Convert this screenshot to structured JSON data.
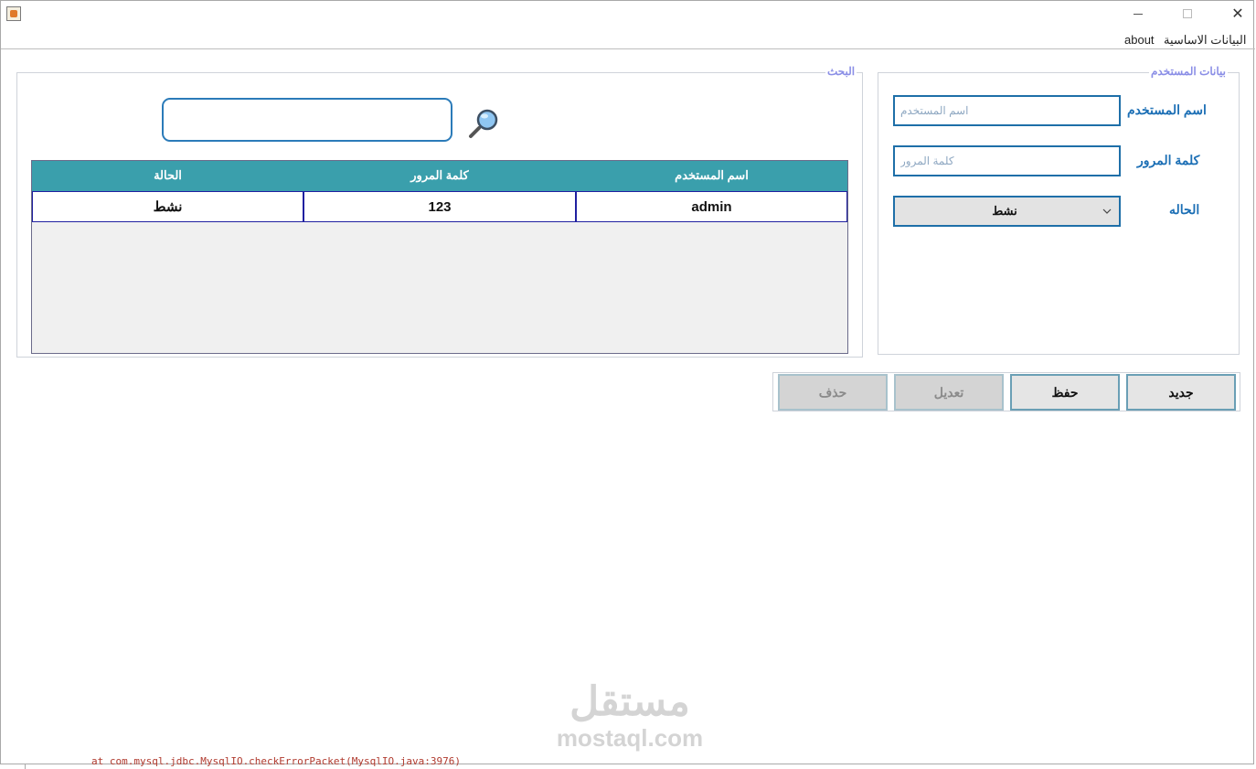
{
  "menubar": {
    "items": [
      {
        "label": "البيانات الاساسية"
      },
      {
        "label": "about"
      }
    ]
  },
  "search_panel": {
    "title": "البحث",
    "search_input": {
      "value": "",
      "placeholder": ""
    },
    "table": {
      "columns": [
        "اسم المستخدم",
        "كلمة المرور",
        "الحالة"
      ],
      "rows": [
        {
          "username": "admin",
          "password": "123",
          "status": "نشط"
        }
      ]
    }
  },
  "user_panel": {
    "title": "بيانات المستخدم",
    "username_label": "اسم المستخدم",
    "username_placeholder": "اسم المستخدم",
    "password_label": "كلمة المرور",
    "password_placeholder": "كلمة المرور",
    "status_label": "الحاله",
    "status_value": "نشط"
  },
  "actions": {
    "new_label": "جديد",
    "save_label": "حفظ",
    "edit_label": "تعديل",
    "delete_label": "حذف"
  },
  "watermark": {
    "arabic": "مستقل",
    "latin": "mostaql.com"
  },
  "console": {
    "line": "at com.mysql.jdbc.MysqlIO.checkErrorPacket(MysqlIO.java:3976)"
  },
  "colors": {
    "table_header": "#3a9fac",
    "label_blue": "#1c6fb5",
    "panel_title": "#8a8ee6",
    "input_border": "#1e6fa8"
  }
}
